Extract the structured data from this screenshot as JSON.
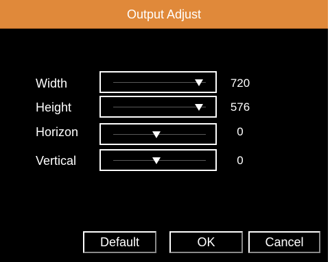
{
  "dialog": {
    "title": "Output Adjust"
  },
  "rows": [
    {
      "label": "Width",
      "value": "720",
      "slider_level": 1.0
    },
    {
      "label": "Height",
      "value": "576",
      "slider_level": 1.0
    },
    {
      "label": "Horizon",
      "value": "0",
      "slider_level": 0.5
    },
    {
      "label": "Vertical",
      "value": "0",
      "slider_level": 0.5
    }
  ],
  "buttons": {
    "default_label": "Default",
    "ok_label": "OK",
    "cancel_label": "Cancel"
  },
  "colors": {
    "title_bar": "#e0893a",
    "background": "#000000",
    "text": "#ffffff"
  },
  "icons": {
    "slider_thumb": "down-triangle-icon"
  }
}
